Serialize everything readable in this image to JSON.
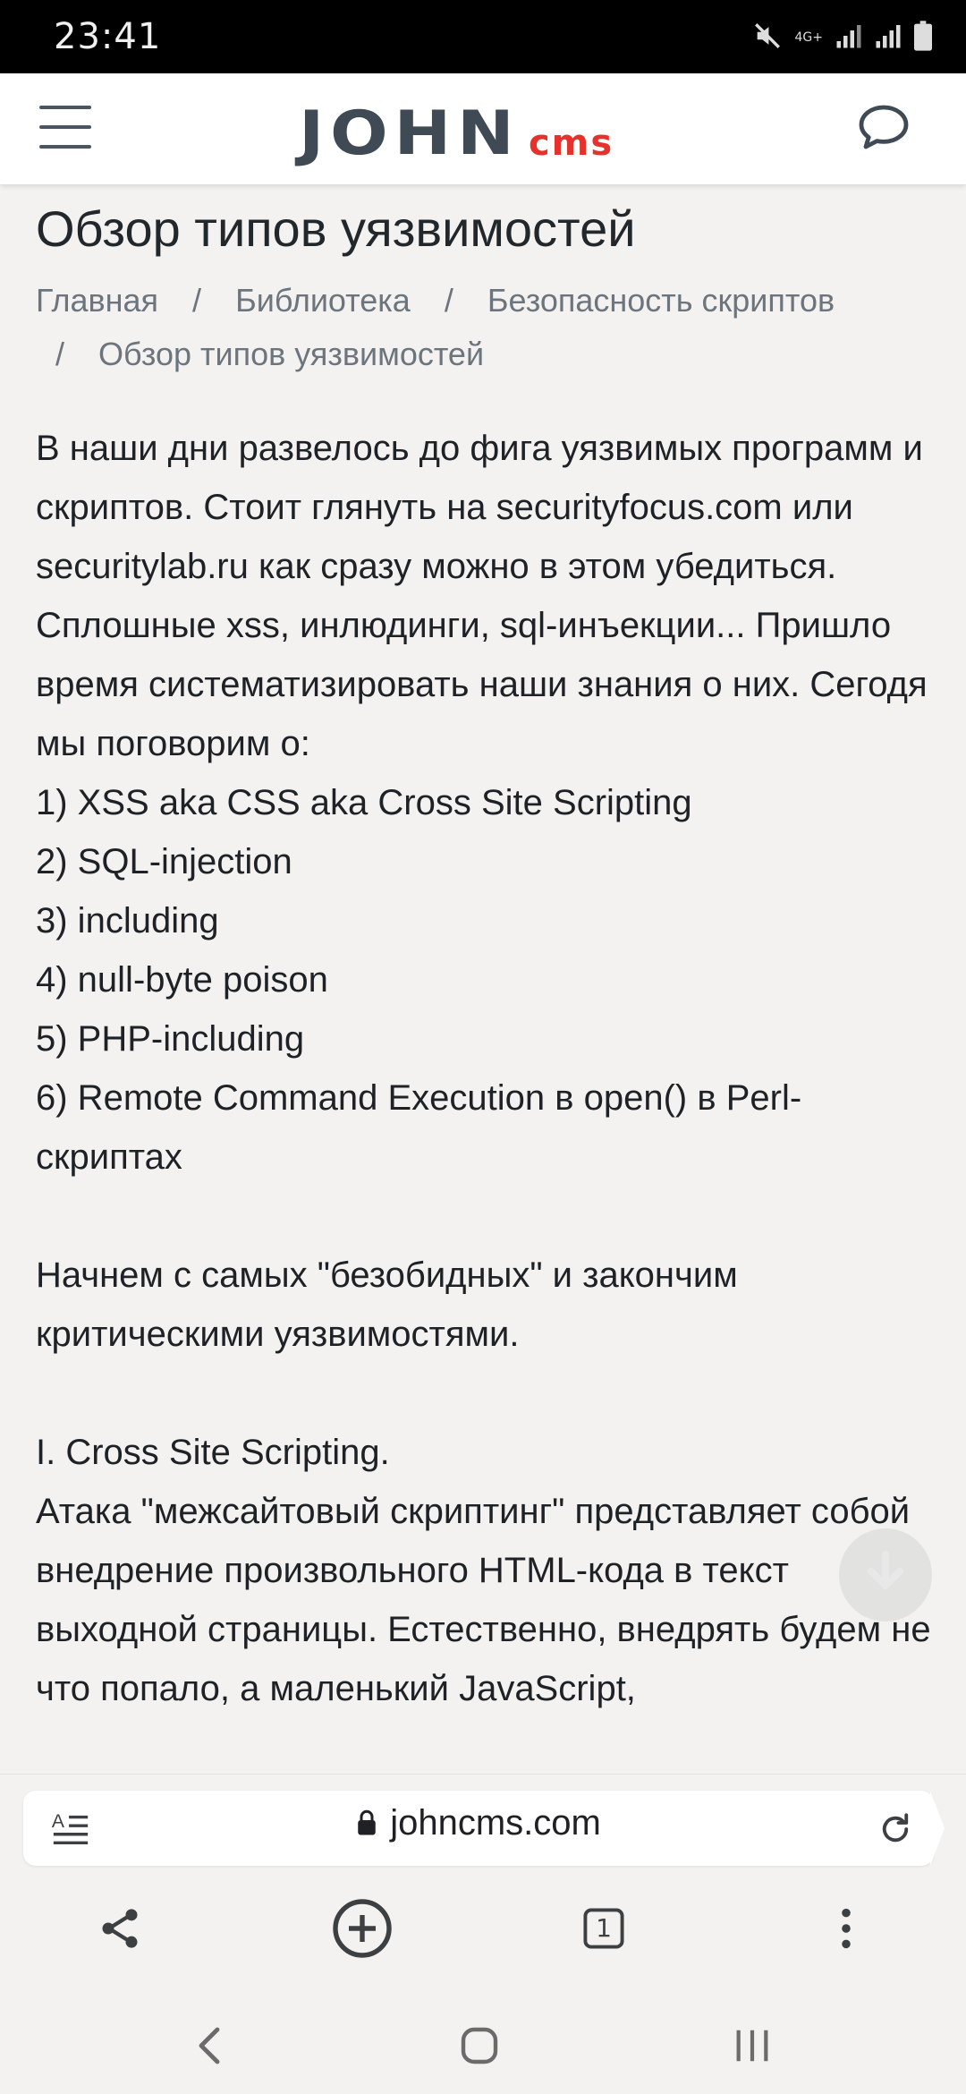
{
  "status": {
    "time": "23:41",
    "network": "4G+",
    "icons": [
      "mute-icon",
      "signal-icon",
      "signal-icon",
      "battery-icon"
    ]
  },
  "header": {
    "logo_main": "JOHN",
    "logo_sub": "cms",
    "menu_icon": "hamburger-icon",
    "chat_icon": "chat-bubble-icon",
    "colors": {
      "logo_main": "#3f4a55",
      "logo_sub": "#e5322d"
    }
  },
  "page": {
    "title": "Обзор типов уязвимостей",
    "breadcrumb": {
      "sep": "/",
      "items": [
        "Главная",
        "Библиотека",
        "Безопасность скриптов",
        "Обзор типов уязвимостей"
      ]
    }
  },
  "article": {
    "intro": "В наши дни развелось до фига уязвимых программ и скриптов. Стоит глянуть на securityfocus.com или securitylab.ru как сразу можно в этом убедиться. Сплошные xss, инлюдинги, sql-инъекции... Пришло время систематизировать наши знания о них. Сегодя мы поговорим о:",
    "list": [
      "1) XSS aka CSS aka Cross Site Scripting",
      "2) SQL-injection",
      "3) including",
      "4) null-byte poison",
      "5) PHP-including",
      "6) Remote Command Execution в open() в Perl-скриптах"
    ],
    "paragraph2": "Начнем с самых \"безобидных\" и закончим критическими уязвимостями.",
    "section_heading": "I. Cross Site Scripting.",
    "paragraph3": "Атака \"межсайтовый скриптинг\" представляет собой внедрение произвольного HTML-кода в текст выходной страницы. Естественно, внедрять будем не что попало, а маленький JavaScript,"
  },
  "browser": {
    "url": "johncms.com",
    "tab_count": "1",
    "icons": [
      "reader-mode-icon",
      "lock-icon",
      "reload-icon",
      "share-icon",
      "new-tab-icon",
      "tabs-icon",
      "more-vertical-icon"
    ]
  },
  "navbar": {
    "icons": [
      "back-icon",
      "home-icon",
      "recents-icon"
    ]
  }
}
